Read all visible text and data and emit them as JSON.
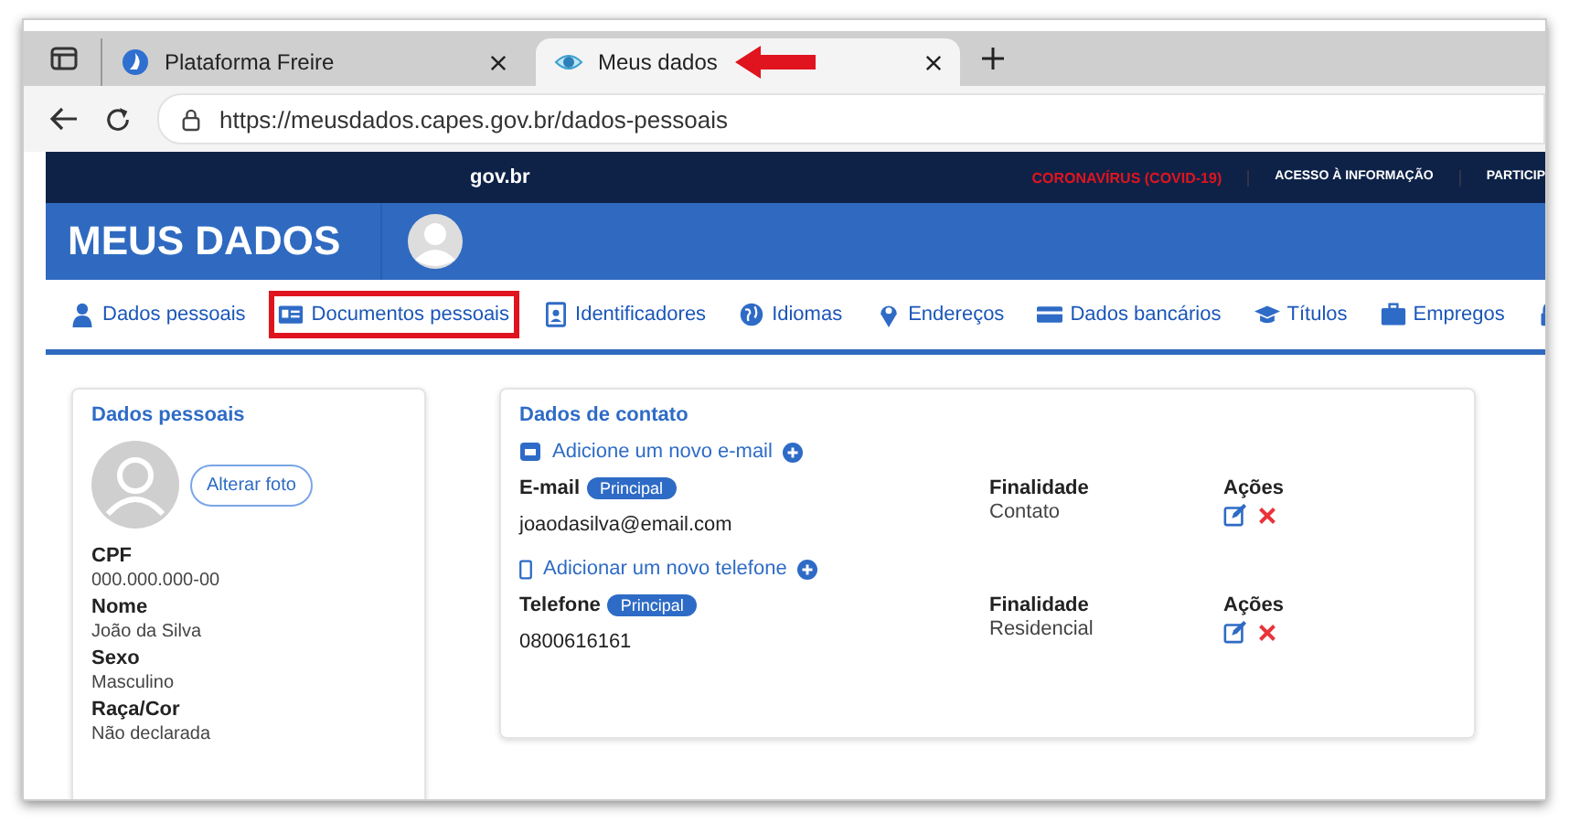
{
  "browser": {
    "tabs": [
      {
        "title": "Plataforma Freire",
        "selected": false,
        "kind": "freire"
      },
      {
        "title": "Meus dados",
        "selected": true,
        "kind": "eye"
      }
    ],
    "url": "https://meusdados.capes.gov.br/dados-pessoais"
  },
  "gov_bar": {
    "logo": "gov.br",
    "links": [
      {
        "label": "CORONAVÍRUS (COVID-19)",
        "kind": "alert"
      },
      {
        "label": "ACESSO À INFORMAÇÃO",
        "kind": "normal"
      },
      {
        "label": "PARTICIP",
        "kind": "normal"
      }
    ]
  },
  "header": {
    "title": "MEUS DADOS"
  },
  "nav": [
    {
      "label": "Dados pessoais",
      "kind": "user",
      "highlighted": false
    },
    {
      "label": "Documentos pessoais",
      "kind": "idcard",
      "highlighted": true
    },
    {
      "label": "Identificadores",
      "kind": "badge",
      "highlighted": false
    },
    {
      "label": "Idiomas",
      "kind": "globe",
      "highlighted": false
    },
    {
      "label": "Endereços",
      "kind": "pin",
      "highlighted": false
    },
    {
      "label": "Dados bancários",
      "kind": "card",
      "highlighted": false
    },
    {
      "label": "Títulos",
      "kind": "cap",
      "highlighted": false
    },
    {
      "label": "Empregos",
      "kind": "briefcase",
      "highlighted": false
    },
    {
      "kind": "lock",
      "highlighted": false
    }
  ],
  "personal": {
    "title": "Dados pessoais",
    "photo_button": "Alterar foto",
    "fields": [
      {
        "label": "CPF",
        "value": "000.000.000-00"
      },
      {
        "label": "Nome",
        "value": "João da Silva"
      },
      {
        "label": "Sexo",
        "value": "Masculino"
      },
      {
        "label": "Raça/Cor",
        "value": "Não declarada"
      }
    ]
  },
  "contact": {
    "title": "Dados de contato",
    "groups": [
      {
        "kind": "email",
        "add_link": "Adicione um novo e-mail",
        "label": "E-mail",
        "badge": "Principal",
        "value": "joaodasilva@email.com",
        "purpose_label": "Finalidade",
        "purpose": "Contato",
        "actions_label": "Ações"
      },
      {
        "kind": "phone",
        "add_link": "Adicionar um novo telefone",
        "label": "Telefone",
        "badge": "Principal",
        "value": "0800616161",
        "purpose_label": "Finalidade",
        "purpose": "Residencial",
        "actions_label": "Ações"
      }
    ]
  }
}
